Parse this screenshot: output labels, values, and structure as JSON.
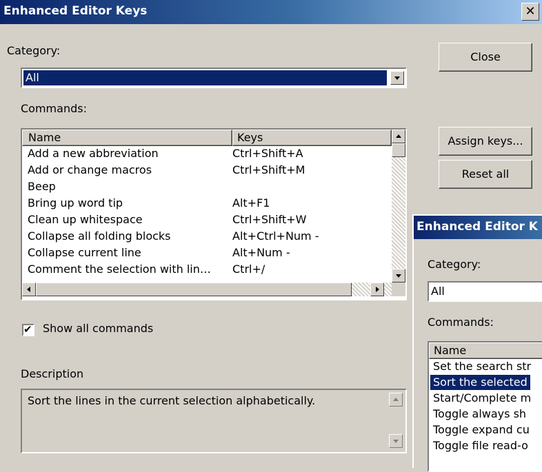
{
  "main": {
    "title": "Enhanced Editor Keys",
    "close_glyph": "✕",
    "category_label": "Category:",
    "category_value": "All",
    "commands_label": "Commands:",
    "columns": {
      "name": "Name",
      "keys": "Keys"
    },
    "rows": [
      {
        "name": "Add a new abbreviation",
        "keys": "Ctrl+Shift+A"
      },
      {
        "name": "Add or change macros",
        "keys": "Ctrl+Shift+M"
      },
      {
        "name": "Beep",
        "keys": ""
      },
      {
        "name": "Bring up word tip",
        "keys": "Alt+F1"
      },
      {
        "name": "Clean up whitespace",
        "keys": "Ctrl+Shift+W"
      },
      {
        "name": "Collapse all folding blocks",
        "keys": "Alt+Ctrl+Num -"
      },
      {
        "name": "Collapse current line",
        "keys": "Alt+Num -"
      },
      {
        "name": "Comment the selection with lin…",
        "keys": "Ctrl+/"
      }
    ],
    "show_all_label": "Show all commands",
    "show_all_checked": true,
    "description_label": "Description",
    "description_text": "Sort the lines in the current selection alphabetically.",
    "buttons": {
      "close": "Close",
      "assign": "Assign keys...",
      "reset": "Reset all"
    }
  },
  "sub": {
    "title": "Enhanced Editor K",
    "category_label": "Category:",
    "category_value": "All",
    "commands_label": "Commands:",
    "column_name": "Name",
    "rows": [
      "Set the search str",
      "Sort the selected",
      "Start/Complete m",
      "Toggle always sh",
      "Toggle expand cu",
      "Toggle file read-o"
    ],
    "selected_index": 1
  },
  "colors": {
    "titlebar": "#0a246a",
    "selection": "#0a246a",
    "face": "#d4d0c8"
  }
}
